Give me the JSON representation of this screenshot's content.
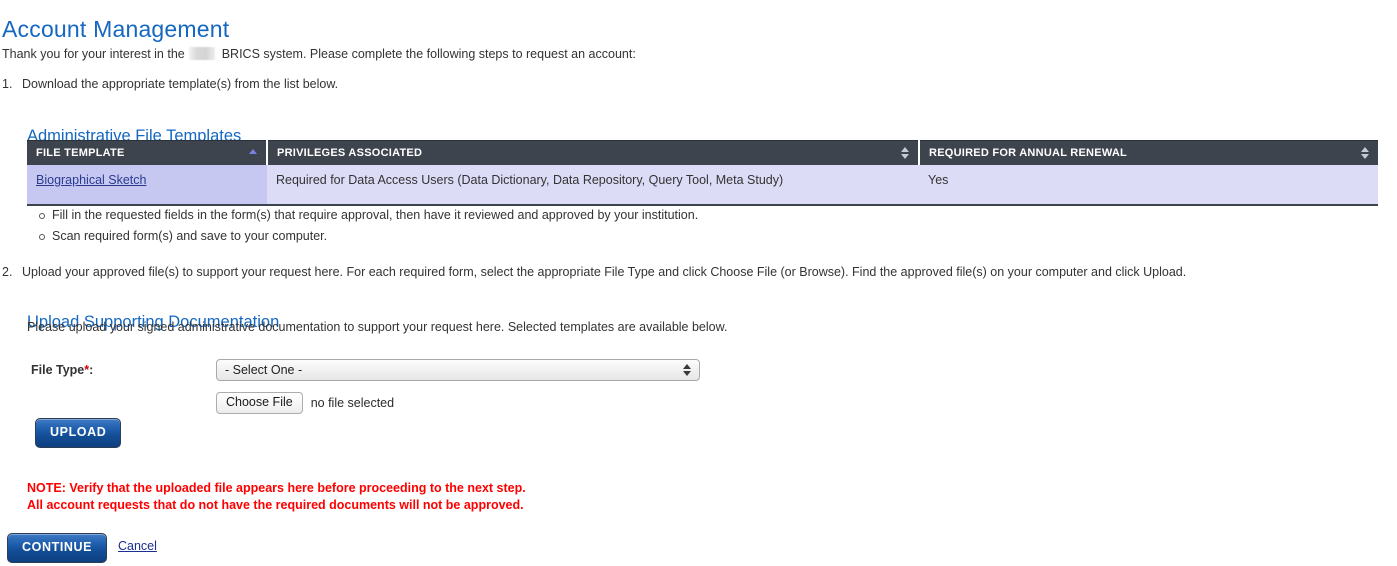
{
  "page": {
    "title": "Account Management",
    "intro_before_redaction": "Thank you for your interest in the",
    "intro_after_redaction": "BRICS system. Please complete the following steps to request an account:"
  },
  "steps": [
    {
      "number": "1.",
      "text": "Download the appropriate template(s) from the list below."
    },
    {
      "number": "2.",
      "text": "Upload your approved file(s) to support your request here. For each required form, select the appropriate File Type and click Choose File (or Browse). Find the approved file(s) on your computer and click Upload."
    }
  ],
  "templates_section": {
    "heading": "Administrative File Templates",
    "columns": [
      {
        "label": "FILE TEMPLATE",
        "sort": "ascending"
      },
      {
        "label": "PRIVILEGES ASSOCIATED",
        "sort": "none"
      },
      {
        "label": "REQUIRED FOR ANNUAL RENEWAL",
        "sort": "none"
      }
    ],
    "rows": [
      {
        "file_template": "Biographical Sketch",
        "privileges": "Required for Data Access Users (Data Dictionary, Data Repository, Query Tool, Meta Study)",
        "annual_renewal": "Yes"
      }
    ]
  },
  "bullets": [
    "Fill in the requested fields in the form(s) that require approval, then have it reviewed and approved by your institution.",
    "Scan required form(s) and save to your computer."
  ],
  "upload_section": {
    "heading": "Upload Supporting Documentation",
    "subtext": "Please upload your signed administrative documentation to support your request here. Selected templates are available below.",
    "file_type_label": "File Type",
    "file_type_required_marker": "*",
    "file_type_label_colon": ":",
    "file_type_value": "- Select One -",
    "choose_file_label": "Choose File",
    "file_status": "no file selected",
    "upload_button_label": "UPLOAD"
  },
  "note": {
    "line1": "NOTE: Verify that the uploaded file appears here before proceeding to the next step.",
    "line2": "All account requests that do not have the required documents will not be approved."
  },
  "footer": {
    "continue_label": "CONTINUE",
    "cancel_label": "Cancel"
  },
  "colors": {
    "heading_blue": "#1567c0",
    "table_header_bg": "#3d444d",
    "row_bg": "#dcdcf7",
    "sorted_col_bg": "#c7c8f2",
    "link_blue": "#2a3b8f",
    "warning_red": "#ff0000",
    "button_blue": "#1f5fae"
  }
}
